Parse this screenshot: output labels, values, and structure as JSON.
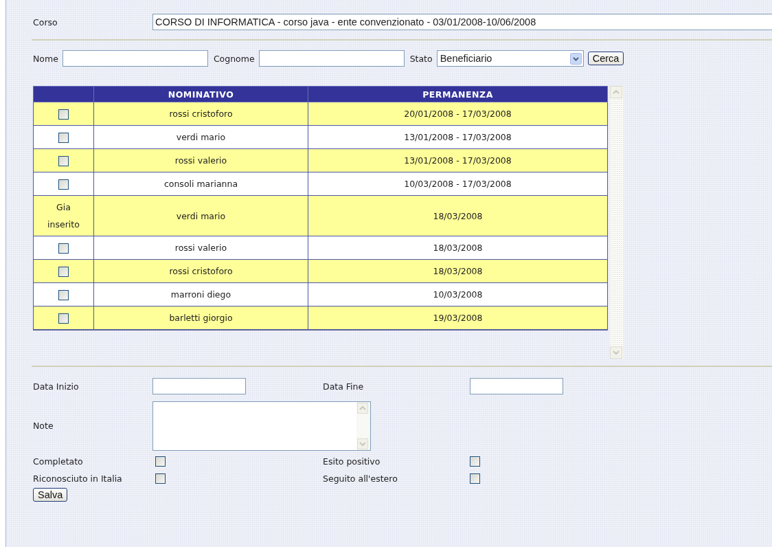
{
  "corso": {
    "label": "Corso",
    "value": "CORSO DI INFORMATICA - corso java -  ente convenzionato  -  03/01/2008-10/06/2008"
  },
  "search": {
    "fields": [
      {
        "label": "Nome"
      },
      {
        "label": "Cognome"
      }
    ],
    "stato": {
      "label": "Stato",
      "value": "Beneficiario"
    },
    "button": "Cerca"
  },
  "table": {
    "columns": [
      "NOMINATIVO",
      "PERMANENZA"
    ],
    "rows": [
      {
        "kind": "checkbox",
        "checked": false,
        "nominativo": "rossi cristoforo",
        "permanenza": "20/01/2008 - 17/03/2008"
      },
      {
        "kind": "checkbox",
        "checked": false,
        "nominativo": "verdi mario",
        "permanenza": "13/01/2008 - 17/03/2008"
      },
      {
        "kind": "checkbox",
        "checked": false,
        "nominativo": "rossi valerio",
        "permanenza": "13/01/2008 - 17/03/2008"
      },
      {
        "kind": "checkbox",
        "checked": false,
        "nominativo": "consoli marianna",
        "permanenza": "10/03/2008 - 17/03/2008"
      },
      {
        "kind": "text",
        "status": "Gia inserito",
        "nominativo": "verdi mario",
        "permanenza": "18/03/2008"
      },
      {
        "kind": "checkbox",
        "checked": false,
        "nominativo": "rossi valerio",
        "permanenza": "18/03/2008"
      },
      {
        "kind": "checkbox",
        "checked": false,
        "nominativo": "rossi cristoforo",
        "permanenza": "18/03/2008"
      },
      {
        "kind": "checkbox",
        "checked": false,
        "nominativo": "marroni diego",
        "permanenza": "10/03/2008"
      },
      {
        "kind": "checkbox",
        "checked": false,
        "nominativo": "barletti giorgio",
        "permanenza": "19/03/2008"
      }
    ]
  },
  "form": {
    "data_inizio": "Data Inizio",
    "data_fine": "Data Fine",
    "note": "Note",
    "checks": [
      {
        "label": "Completato",
        "checked": false
      },
      {
        "label": "Esito positivo",
        "checked": false
      },
      {
        "label": "Riconosciuto in Italia",
        "checked": false
      },
      {
        "label": "Seguito all'estero",
        "checked": false
      }
    ],
    "button": "Salva"
  }
}
